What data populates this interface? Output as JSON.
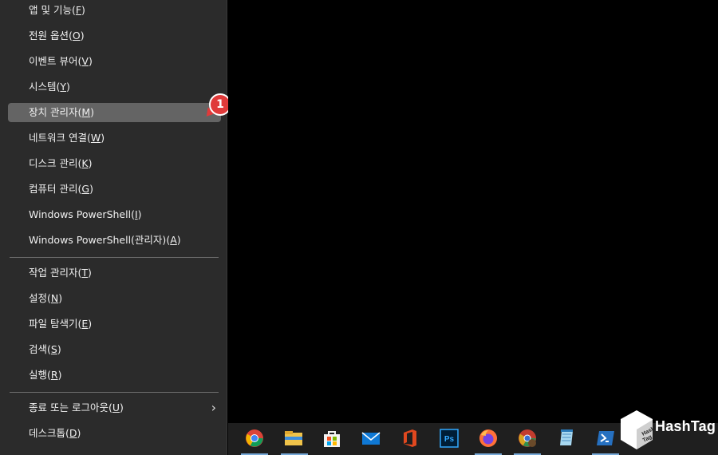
{
  "menu": {
    "items": [
      {
        "label": "앱 및 기능",
        "hotkey": "F",
        "pre": "(",
        "post": ")"
      },
      {
        "label": "전원 옵션",
        "hotkey": "O",
        "pre": "(",
        "post": ")"
      },
      {
        "label": "이벤트 뷰어",
        "hotkey": "V",
        "pre": "(",
        "post": ")"
      },
      {
        "label": "시스템",
        "hotkey": "Y",
        "pre": "(",
        "post": ")"
      },
      {
        "label": "장치 관리자",
        "hotkey": "M",
        "pre": "(",
        "post": ")"
      },
      {
        "label": "네트워크 연결",
        "hotkey": "W",
        "pre": "(",
        "post": ")"
      },
      {
        "label": "디스크 관리",
        "hotkey": "K",
        "pre": "(",
        "post": ")"
      },
      {
        "label": "컴퓨터 관리",
        "hotkey": "G",
        "pre": "(",
        "post": ")"
      },
      {
        "label": "Windows PowerShell",
        "hotkey": "I",
        "pre": "(",
        "post": ")"
      },
      {
        "label": "Windows PowerShell(관리자)",
        "hotkey": "A",
        "pre": "(",
        "post": ")"
      },
      {
        "label": "작업 관리자",
        "hotkey": "T",
        "pre": "(",
        "post": ")"
      },
      {
        "label": "설정",
        "hotkey": "N",
        "pre": "(",
        "post": ")"
      },
      {
        "label": "파일 탐색기",
        "hotkey": "E",
        "pre": "(",
        "post": ")"
      },
      {
        "label": "검색",
        "hotkey": "S",
        "pre": "(",
        "post": ")"
      },
      {
        "label": "실행",
        "hotkey": "R",
        "pre": "(",
        "post": ")"
      },
      {
        "label": "종료 또는 로그아웃",
        "hotkey": "U",
        "pre": "(",
        "post": ")"
      },
      {
        "label": "데스크톱",
        "hotkey": "D",
        "pre": "(",
        "post": ")"
      }
    ],
    "active_item": "장치 관리자(M)"
  },
  "callout": {
    "number": "1",
    "color": "#e03a3a"
  },
  "taskbar": {
    "icons": [
      "chrome-icon",
      "file-explorer-icon",
      "store-icon",
      "mail-icon",
      "office-icon",
      "photoshop-icon",
      "firefox-icon",
      "chrome-canary-icon",
      "notepad-icon",
      "powershell-icon"
    ],
    "photoshop_text": "Ps"
  },
  "watermark": {
    "text": "HashTag",
    "logo_text": "Hash Tag"
  },
  "colors": {
    "menu_bg": "#2b2b2b",
    "active_bg": "#646464",
    "taskbar_bg": "#1f1f1f",
    "desktop_bg": "#000000"
  }
}
